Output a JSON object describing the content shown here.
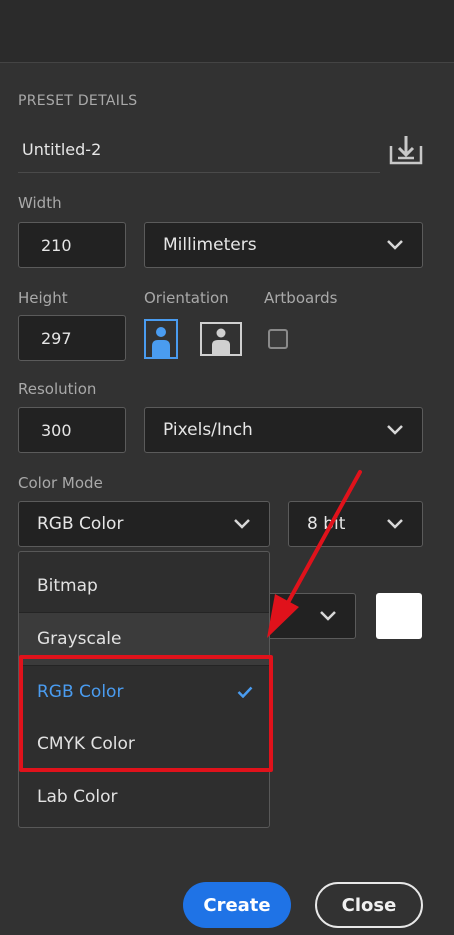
{
  "section": {
    "title": "PRESET DETAILS"
  },
  "preset": {
    "name": "Untitled-2"
  },
  "width": {
    "label": "Width",
    "value": "210",
    "unit": "Millimeters"
  },
  "height": {
    "label": "Height",
    "value": "297"
  },
  "orientation": {
    "label": "Orientation",
    "selected": "portrait"
  },
  "artboards": {
    "label": "Artboards",
    "checked": false
  },
  "resolution": {
    "label": "Resolution",
    "value": "300",
    "unit": "Pixels/Inch"
  },
  "color_mode": {
    "label": "Color Mode",
    "value": "RGB Color",
    "bit_depth": "8 bit",
    "options": [
      {
        "label": "Bitmap",
        "selected": false
      },
      {
        "label": "Grayscale",
        "selected": false
      },
      {
        "label": "RGB Color",
        "selected": true
      },
      {
        "label": "CMYK Color",
        "selected": false
      },
      {
        "label": "Lab Color",
        "selected": false
      }
    ]
  },
  "background": {
    "color": "#ffffff"
  },
  "buttons": {
    "create": "Create",
    "close": "Close"
  },
  "colors": {
    "accent": "#1f73e6",
    "selected_text": "#4a9cf0",
    "highlight": "#e0121b"
  },
  "icons": {
    "save": "save-preset-icon",
    "chevron": "chevron-down-icon",
    "portrait": "portrait-orientation-icon",
    "landscape": "landscape-orientation-icon",
    "check": "checkmark-icon"
  }
}
